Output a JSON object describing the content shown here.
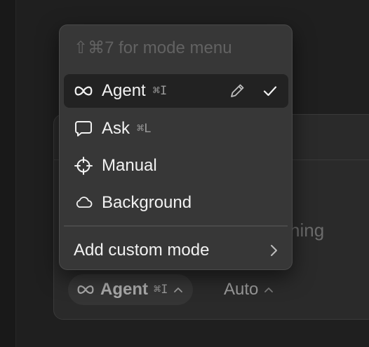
{
  "menu": {
    "hint": "⇧⌘7 for mode menu",
    "items": [
      {
        "label": "Agent",
        "shortcut": "⌘I",
        "icon": "infinity-icon",
        "selected": true
      },
      {
        "label": "Ask",
        "shortcut": "⌘L",
        "icon": "chat-bubble-icon",
        "selected": false
      },
      {
        "label": "Manual",
        "shortcut": "",
        "icon": "crosshair-icon",
        "selected": false
      },
      {
        "label": "Background",
        "shortcut": "",
        "icon": "cloud-icon",
        "selected": false
      }
    ],
    "add_custom": "Add custom mode"
  },
  "composer": {
    "placeholder_fragment": "hing",
    "mode_chip": {
      "label": "Agent",
      "shortcut": "⌘I"
    },
    "model_chip": {
      "label": "Auto"
    }
  },
  "colors": {
    "background": "#1f1f1f",
    "menu_bg": "#373737",
    "selected_row": "#222222",
    "muted_text": "#626262"
  }
}
